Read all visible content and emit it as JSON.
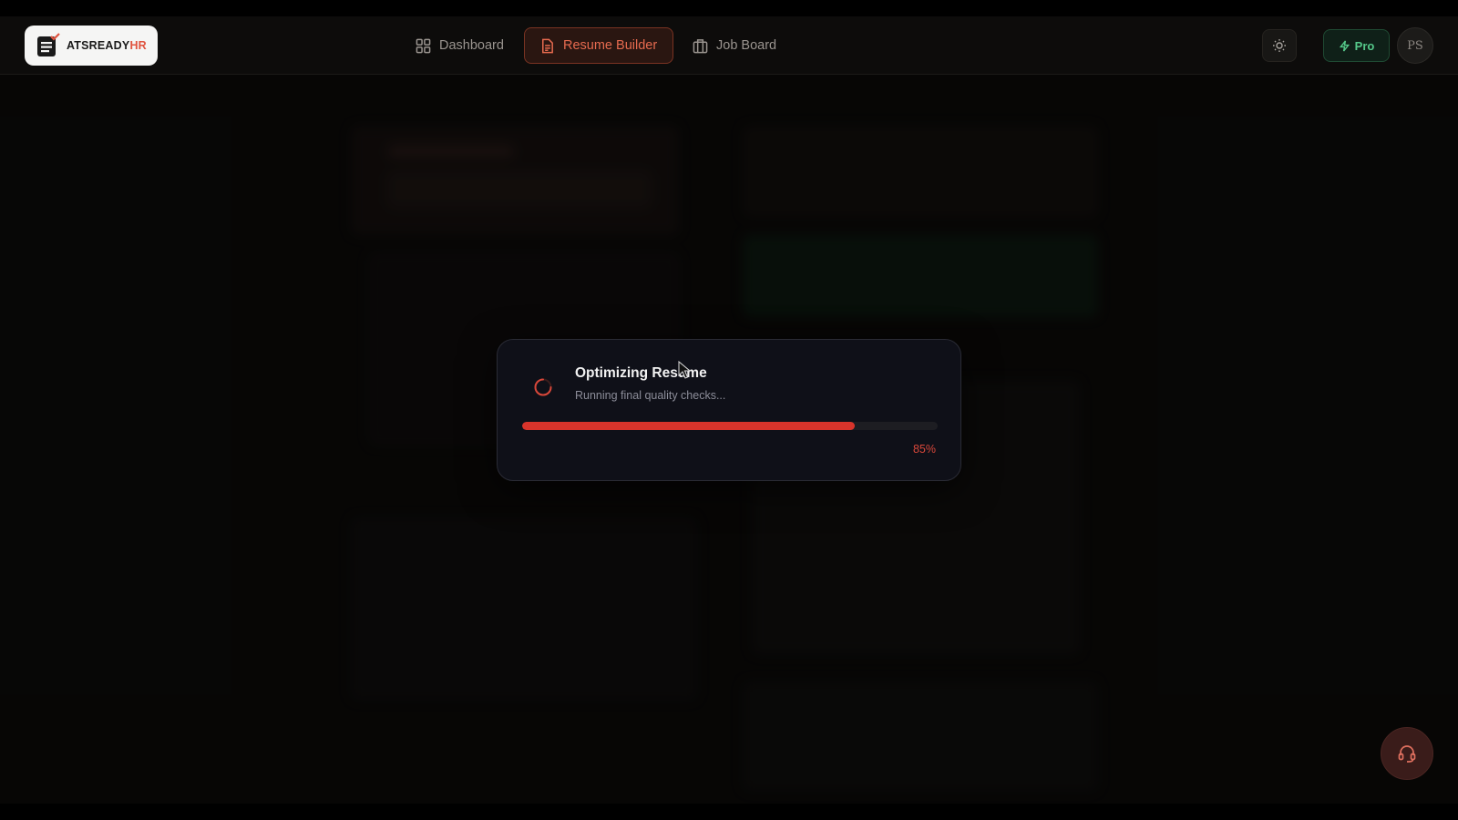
{
  "brand": {
    "name_main": "ATSREADY",
    "name_accent": "HR",
    "accent_color": "#e0533f"
  },
  "nav": {
    "items": [
      {
        "label": "Dashboard",
        "icon": "dashboard-grid-icon",
        "active": false
      },
      {
        "label": "Resume Builder",
        "icon": "document-icon",
        "active": true
      },
      {
        "label": "Job Board",
        "icon": "briefcase-icon",
        "active": false
      }
    ]
  },
  "header": {
    "theme_toggle_icon": "sun-icon",
    "pro_label": "Pro",
    "pro_icon": "lightning-icon",
    "avatar_initials": "PS"
  },
  "modal": {
    "title": "Optimizing Resume",
    "subtitle": "Running final quality checks...",
    "progress_percent": 80,
    "progress_label": "85%",
    "spinner_icon": "loading-spinner-icon",
    "progress_color": "#d8342b"
  },
  "support": {
    "icon": "headset-icon"
  }
}
